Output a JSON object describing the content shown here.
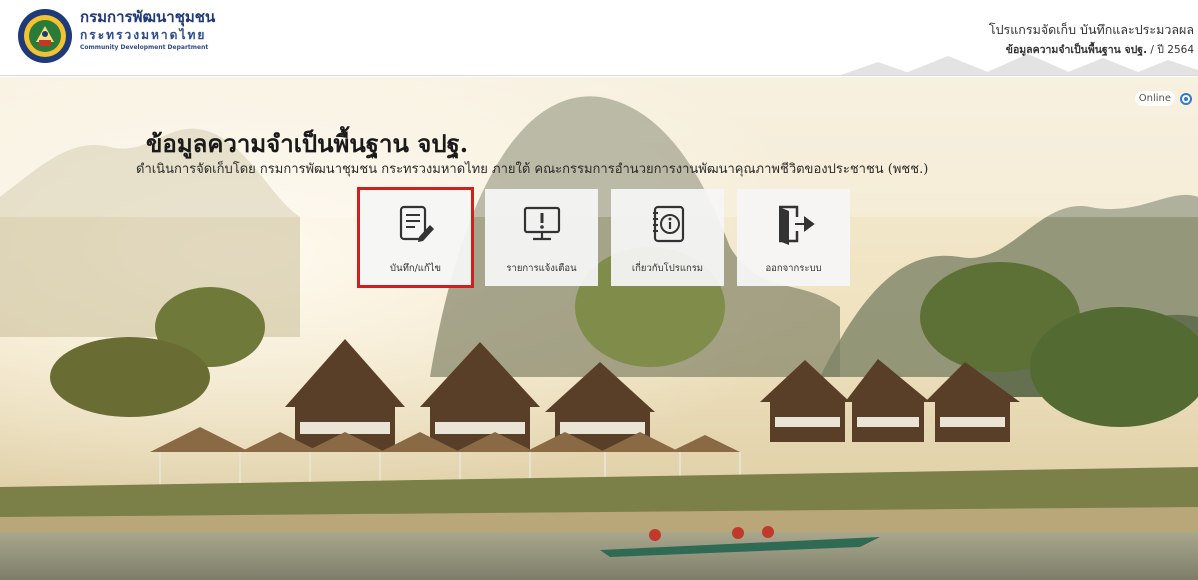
{
  "header": {
    "org_name": "กรมการพัฒนาชุมชน",
    "org_ministry": "กระทรวงมหาดไทย",
    "org_en": "Community Development Department",
    "program_title": "โปรแกรมจัดเก็บ บันทึกและประมวลผล",
    "program_sub_bold": "ข้อมูลความจำเป็นพื้นฐาน จปฐ.",
    "program_sub_year": " / ปี 2564"
  },
  "status": {
    "online_label": "Online"
  },
  "hero": {
    "title": "ข้อมูลความจำเป็นพื้นฐาน จปฐ.",
    "description": "ดำเนินการจัดเก็บโดย กรมการพัฒนาชุมชน กระทรวงมหาดไทย ภายใต้ คณะกรรมการอำนวยการงานพัฒนาคุณภาพชีวิตของประชาชน (พชช.)"
  },
  "menu": [
    {
      "label": "บันทึก/แก้ไข",
      "icon": "edit-document-icon",
      "active": true
    },
    {
      "label": "รายการแจ้งเตือน",
      "icon": "monitor-alert-icon",
      "active": false
    },
    {
      "label": "เกี่ยวกับโปรแกรม",
      "icon": "info-notebook-icon",
      "active": false
    },
    {
      "label": "ออกจากระบบ",
      "icon": "logout-door-icon",
      "active": false
    }
  ],
  "colors": {
    "brand_blue": "#1f3a78",
    "active_border": "#d11f1f",
    "online_blue": "#2e7bd1"
  }
}
